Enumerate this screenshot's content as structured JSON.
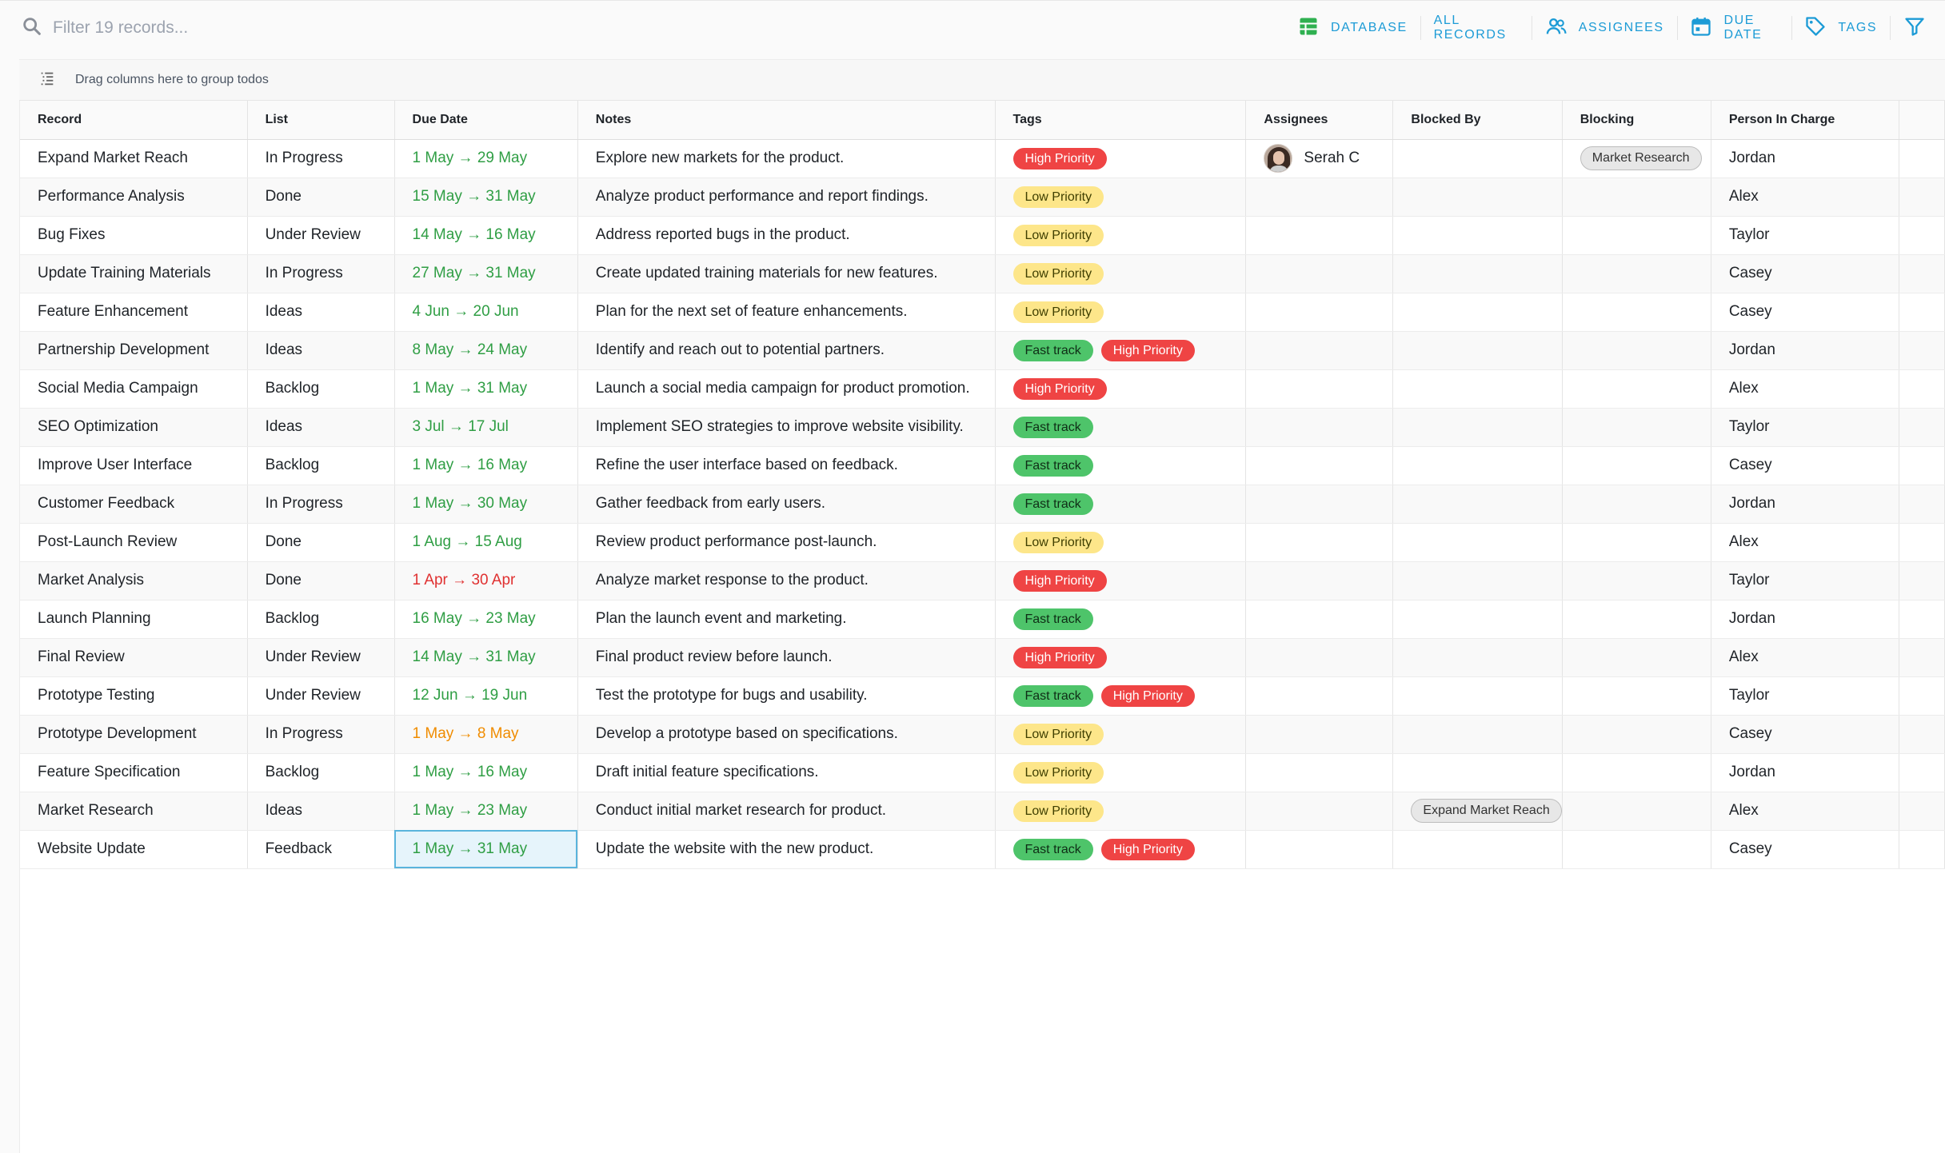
{
  "search": {
    "placeholder": "Filter 19 records..."
  },
  "toolbar": {
    "views": [
      {
        "label": "DATABASE",
        "icon": "table-icon",
        "color": "#2fb050"
      },
      {
        "label": "ALL RECORDS"
      },
      {
        "label": "ASSIGNEES",
        "icon": "people-icon",
        "color": "#1c9bd6"
      },
      {
        "label": "DUE DATE",
        "icon": "calendar-icon",
        "color": "#1c9bd6"
      },
      {
        "label": "TAGS",
        "icon": "tag-icon",
        "color": "#1c9bd6"
      }
    ]
  },
  "groupbar": {
    "label": "Drag columns here to group todos"
  },
  "columns": [
    "Record",
    "List",
    "Due Date",
    "Notes",
    "Tags",
    "Assignees",
    "Blocked By",
    "Blocking",
    "Person In Charge"
  ],
  "tag_colors": {
    "High Priority": "#ef4444",
    "Low Priority": "#fde68a",
    "Fast track": "#4ec46a"
  },
  "date_colors": {
    "ok": "#2f9e44",
    "overdue": "#e03131",
    "due_soon": "#f08c00"
  },
  "rows": [
    {
      "record": "Expand Market Reach",
      "list": "In Progress",
      "due": "1 May → 29 May",
      "due_status": "ok",
      "notes": "Explore new markets for the product.",
      "tags": [
        "High Priority"
      ],
      "assignees": [
        "Serah C"
      ],
      "blocked_by": "",
      "blocking": "Market Research",
      "person": "Jordan"
    },
    {
      "record": "Performance Analysis",
      "list": "Done",
      "due": "15 May → 31 May",
      "due_status": "ok",
      "notes": "Analyze product performance and report findings.",
      "tags": [
        "Low Priority"
      ],
      "assignees": [],
      "blocked_by": "",
      "blocking": "",
      "person": "Alex"
    },
    {
      "record": "Bug Fixes",
      "list": "Under Review",
      "due": "14 May → 16 May",
      "due_status": "ok",
      "notes": "Address reported bugs in the product.",
      "tags": [
        "Low Priority"
      ],
      "assignees": [],
      "blocked_by": "",
      "blocking": "",
      "person": "Taylor"
    },
    {
      "record": "Update Training Materials",
      "list": "In Progress",
      "due": "27 May → 31 May",
      "due_status": "ok",
      "notes": "Create updated training materials for new features.",
      "tags": [
        "Low Priority"
      ],
      "assignees": [],
      "blocked_by": "",
      "blocking": "",
      "person": "Casey"
    },
    {
      "record": "Feature Enhancement",
      "list": "Ideas",
      "due": "4 Jun → 20 Jun",
      "due_status": "ok",
      "notes": "Plan for the next set of feature enhancements.",
      "tags": [
        "Low Priority"
      ],
      "assignees": [],
      "blocked_by": "",
      "blocking": "",
      "person": "Casey"
    },
    {
      "record": "Partnership Development",
      "list": "Ideas",
      "due": "8 May → 24 May",
      "due_status": "ok",
      "notes": "Identify and reach out to potential partners.",
      "tags": [
        "Fast track",
        "High Priority"
      ],
      "assignees": [],
      "blocked_by": "",
      "blocking": "",
      "person": "Jordan"
    },
    {
      "record": "Social Media Campaign",
      "list": "Backlog",
      "due": "1 May → 31 May",
      "due_status": "ok",
      "notes": "Launch a social media campaign for product promotion.",
      "tags": [
        "High Priority"
      ],
      "assignees": [],
      "blocked_by": "",
      "blocking": "",
      "person": "Alex"
    },
    {
      "record": "SEO Optimization",
      "list": "Ideas",
      "due": "3 Jul → 17 Jul",
      "due_status": "ok",
      "notes": "Implement SEO strategies to improve website visibility.",
      "tags": [
        "Fast track"
      ],
      "assignees": [],
      "blocked_by": "",
      "blocking": "",
      "person": "Taylor"
    },
    {
      "record": "Improve User Interface",
      "list": "Backlog",
      "due": "1 May → 16 May",
      "due_status": "ok",
      "notes": "Refine the user interface based on feedback.",
      "tags": [
        "Fast track"
      ],
      "assignees": [],
      "blocked_by": "",
      "blocking": "",
      "person": "Casey"
    },
    {
      "record": "Customer Feedback",
      "list": "In Progress",
      "due": "1 May → 30 May",
      "due_status": "ok",
      "notes": "Gather feedback from early users.",
      "tags": [
        "Fast track"
      ],
      "assignees": [],
      "blocked_by": "",
      "blocking": "",
      "person": "Jordan"
    },
    {
      "record": "Post-Launch Review",
      "list": "Done",
      "due": "1 Aug → 15 Aug",
      "due_status": "ok",
      "notes": "Review product performance post-launch.",
      "tags": [
        "Low Priority"
      ],
      "assignees": [],
      "blocked_by": "",
      "blocking": "",
      "person": "Alex"
    },
    {
      "record": "Market Analysis",
      "list": "Done",
      "due": "1 Apr → 30 Apr",
      "due_status": "overdue",
      "notes": "Analyze market response to the product.",
      "tags": [
        "High Priority"
      ],
      "assignees": [],
      "blocked_by": "",
      "blocking": "",
      "person": "Taylor"
    },
    {
      "record": "Launch Planning",
      "list": "Backlog",
      "due": "16 May → 23 May",
      "due_status": "ok",
      "notes": "Plan the launch event and marketing.",
      "tags": [
        "Fast track"
      ],
      "assignees": [],
      "blocked_by": "",
      "blocking": "",
      "person": "Jordan"
    },
    {
      "record": "Final Review",
      "list": "Under Review",
      "due": "14 May → 31 May",
      "due_status": "ok",
      "notes": "Final product review before launch.",
      "tags": [
        "High Priority"
      ],
      "assignees": [],
      "blocked_by": "",
      "blocking": "",
      "person": "Alex"
    },
    {
      "record": "Prototype Testing",
      "list": "Under Review",
      "due": "12 Jun → 19 Jun",
      "due_status": "ok",
      "notes": "Test the prototype for bugs and usability.",
      "tags": [
        "Fast track",
        "High Priority"
      ],
      "assignees": [],
      "blocked_by": "",
      "blocking": "",
      "person": "Taylor"
    },
    {
      "record": "Prototype Development",
      "list": "In Progress",
      "due": "1 May → 8 May",
      "due_status": "due_soon",
      "notes": "Develop a prototype based on specifications.",
      "tags": [
        "Low Priority"
      ],
      "assignees": [],
      "blocked_by": "",
      "blocking": "",
      "person": "Casey"
    },
    {
      "record": "Feature Specification",
      "list": "Backlog",
      "due": "1 May → 16 May",
      "due_status": "ok",
      "notes": "Draft initial feature specifications.",
      "tags": [
        "Low Priority"
      ],
      "assignees": [],
      "blocked_by": "",
      "blocking": "",
      "person": "Jordan"
    },
    {
      "record": "Market Research",
      "list": "Ideas",
      "due": "1 May → 23 May",
      "due_status": "ok",
      "notes": "Conduct initial market research for product.",
      "tags": [
        "Low Priority"
      ],
      "assignees": [],
      "blocked_by": "Expand Market Reach",
      "blocking": "",
      "person": "Alex"
    },
    {
      "record": "Website Update",
      "list": "Feedback",
      "due": "1 May → 31 May",
      "due_status": "ok",
      "notes": "Update the website with the new product.",
      "tags": [
        "Fast track",
        "High Priority"
      ],
      "assignees": [],
      "blocked_by": "",
      "blocking": "",
      "person": "Casey",
      "selected_cell": "due"
    }
  ]
}
